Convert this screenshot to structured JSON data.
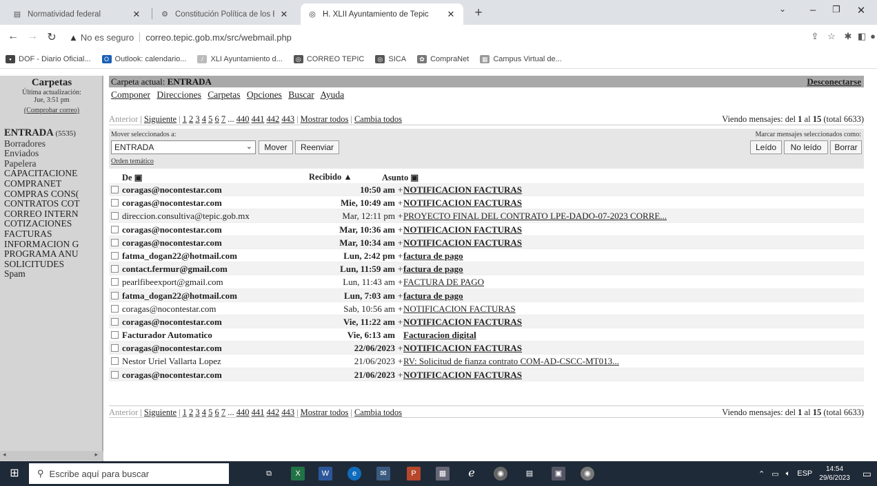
{
  "browser": {
    "tabs": [
      {
        "title": "Normatividad federal",
        "active": false
      },
      {
        "title": "Constitución Política de los Esta",
        "active": false
      },
      {
        "title": "H. XLII Ayuntamiento de Tepic",
        "active": true
      }
    ],
    "new_tab": "+",
    "address": {
      "warning": "▲",
      "insecure_label": "No es seguro",
      "url": "correo.tepic.gob.mx/src/webmail.php"
    },
    "bookmarks": [
      {
        "label": "DOF - Diario Oficial...",
        "icon_color": "#444444"
      },
      {
        "label": "Outlook: calendario...",
        "icon_color": "#1a5fb4"
      },
      {
        "label": "XLI Ayuntamiento d...",
        "icon_color": "#bbbbbb"
      },
      {
        "label": "CORREO TEPIC",
        "icon_color": "#555555"
      },
      {
        "label": "SICA",
        "icon_color": "#555555"
      },
      {
        "label": "CompraNet",
        "icon_color": "#777777"
      },
      {
        "label": "Campus Virtual de...",
        "icon_color": "#999999"
      }
    ]
  },
  "left": {
    "title": "Carpetas",
    "last_update_label": "Última actualización:",
    "last_update_time": "Jue, 3:51 pm",
    "check_mail": "(Comprobar correo)",
    "inbox": {
      "label": "ENTRADA",
      "count": "(5535)"
    },
    "folders": [
      "Borradores",
      "Enviados",
      "Papelera"
    ],
    "bold_folders": [
      "CAPACITACIONE",
      "COMPRANET",
      "COMPRAS CONS(",
      "CONTRATOS COT",
      "CORREO INTERN",
      "COTIZACIONES",
      "FACTURAS",
      "INFORMACION G",
      "PROGRAMA ANU",
      "SOLICITUDES",
      "Spam"
    ]
  },
  "main": {
    "current_folder_label": "Carpeta actual:",
    "current_folder": "ENTRADA",
    "logout": "Desconectarse",
    "menu": [
      "Componer",
      "Direcciones",
      "Carpetas",
      "Opciones",
      "Buscar",
      "Ayuda"
    ],
    "pager": {
      "prev": "Anterior",
      "next": "Siguiente",
      "pages_a": [
        "1",
        "2",
        "3",
        "4",
        "5",
        "6",
        "7"
      ],
      "ellipsis": "...",
      "pages_b": [
        "440",
        "441",
        "442",
        "443"
      ],
      "show_all": "Mostrar todos",
      "toggle_all": "Cambia todos",
      "viewing_prefix": "Viendo mensajes: del",
      "from_n": "1",
      "to_word": "al",
      "to_n": "15",
      "total": "(total 6633)"
    },
    "actions": {
      "move_label": "Mover seleccionados a:",
      "move_value": "ENTRADA",
      "move_button": "Mover",
      "forward_button": "Reenviar",
      "thread_link": "Orden temático",
      "mark_label": "Marcar mensajes seleccionados como:",
      "read_button": "Leído",
      "unread_button": "No leído",
      "delete_button": "Borrar"
    },
    "columns": {
      "from": "De",
      "received": "Recibido",
      "subject": "Asunto"
    },
    "messages": [
      {
        "from": "coragas@nocontestar.com",
        "date": "10:50 am",
        "plus": "+",
        "subject": "NOTIFICACION FACTURAS",
        "unread": true
      },
      {
        "from": "coragas@nocontestar.com",
        "date": "Mie, 10:49 am",
        "plus": "+",
        "subject": "NOTIFICACION FACTURAS",
        "unread": true
      },
      {
        "from": "direccion.consultiva@tepic.gob.mx",
        "date": "Mar, 12:11 pm",
        "plus": "+",
        "subject": "PROYECTO FINAL DEL CONTRATO LPE-DADO-07-2023 CORRE...",
        "unread": false
      },
      {
        "from": "coragas@nocontestar.com",
        "date": "Mar, 10:36 am",
        "plus": "+",
        "subject": "NOTIFICACION FACTURAS",
        "unread": true
      },
      {
        "from": "coragas@nocontestar.com",
        "date": "Mar, 10:34 am",
        "plus": "+",
        "subject": "NOTIFICACION FACTURAS",
        "unread": true
      },
      {
        "from": "fatma_dogan22@hotmail.com",
        "date": "Lun, 2:42 pm",
        "plus": "+",
        "subject": "factura de pago",
        "unread": true
      },
      {
        "from": "contact.fermur@gmail.com",
        "date": "Lun, 11:59 am",
        "plus": "+",
        "subject": "factura de pago",
        "unread": true
      },
      {
        "from": "pearlfibeexport@gmail.com",
        "date": "Lun, 11:43 am",
        "plus": "+",
        "subject": "FACTURA DE PAGO",
        "unread": false
      },
      {
        "from": "fatma_dogan22@hotmail.com",
        "date": "Lun, 7:03 am",
        "plus": "+",
        "subject": "factura de pago",
        "unread": true
      },
      {
        "from": "coragas@nocontestar.com",
        "date": "Sab, 10:56 am",
        "plus": "+",
        "subject": "NOTIFICACION FACTURAS",
        "unread": false
      },
      {
        "from": "coragas@nocontestar.com",
        "date": "Vie, 11:22 am",
        "plus": "+",
        "subject": "NOTIFICACION FACTURAS",
        "unread": true
      },
      {
        "from": "Facturador Automatico",
        "date": "Vie, 6:13 am",
        "plus": "",
        "subject": "Facturacion digital",
        "unread": true
      },
      {
        "from": "coragas@nocontestar.com",
        "date": "22/06/2023",
        "plus": "+",
        "subject": "NOTIFICACION FACTURAS",
        "unread": true
      },
      {
        "from": "Nestor Uriel Vallarta Lopez",
        "date": "21/06/2023",
        "plus": "+",
        "subject": "RV: Solicitud de fianza contrato COM-AD-CSCC-MT013...",
        "unread": false
      },
      {
        "from": "coragas@nocontestar.com",
        "date": "21/06/2023",
        "plus": "+",
        "subject": "NOTIFICACION FACTURAS",
        "unread": true
      }
    ]
  },
  "taskbar": {
    "search_placeholder": "Escribe aquí para buscar",
    "lang": "ESP",
    "time": "14:54",
    "date": "29/6/2023"
  }
}
